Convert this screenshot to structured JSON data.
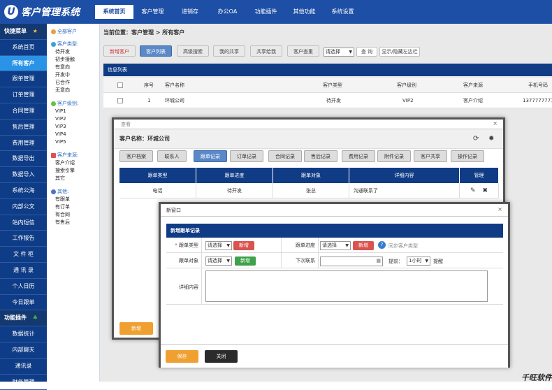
{
  "app": {
    "title": "客户管理系统",
    "logo": "U"
  },
  "topnav": [
    {
      "label": "系统首页"
    },
    {
      "label": "客户管理"
    },
    {
      "label": "进销存"
    },
    {
      "label": "办公OA"
    },
    {
      "label": "功能插件"
    },
    {
      "label": "其他功能"
    },
    {
      "label": "系统设置"
    }
  ],
  "sidebar": {
    "quick": "快捷菜单",
    "items": [
      {
        "label": "系统首页"
      },
      {
        "label": "所有客户"
      },
      {
        "label": "跟单管理"
      },
      {
        "label": "订单管理"
      },
      {
        "label": "合同管理"
      },
      {
        "label": "售后管理"
      },
      {
        "label": "费用管理"
      },
      {
        "label": "数据导出"
      },
      {
        "label": "数据导入"
      },
      {
        "label": "系统公海"
      },
      {
        "label": "内部公文"
      },
      {
        "label": "站内短信"
      },
      {
        "label": "工作报告"
      },
      {
        "label": "文 件 柜"
      },
      {
        "label": "通 讯 录"
      },
      {
        "label": "个人日历"
      },
      {
        "label": "今日跟单"
      }
    ],
    "plugins": "功能插件",
    "items2": [
      {
        "label": "数据统计"
      },
      {
        "label": "内部聊天"
      },
      {
        "label": "通讯录"
      },
      {
        "label": "财务管理"
      }
    ]
  },
  "tree": {
    "all": "全部客户",
    "g1": {
      "title": "客户类型:",
      "items": [
        "待开发",
        "初步接触",
        "有意向",
        "开发中",
        "已合作",
        "无意向"
      ]
    },
    "g2": {
      "title": "客户级别:",
      "items": [
        "VIP1",
        "VIP2",
        "VIP3",
        "VIP4",
        "VIP5"
      ]
    },
    "g3": {
      "title": "客户来源:",
      "items": [
        "客户介绍",
        "搜索引擎",
        "其它"
      ]
    },
    "g4": {
      "title": "其他:",
      "items": [
        "有跟单",
        "有订单",
        "有合同",
        "有售后"
      ]
    }
  },
  "main": {
    "breadcrumb": "当前位置：客户管理 > 所有客户",
    "toolbar": [
      "新增客户",
      "客户列表",
      "高级搜索",
      "我的共享",
      "共享给我",
      "客户查重"
    ],
    "select": "请选择",
    "search": "查 询",
    "toggle": "显示/隐藏左边栏",
    "info": "信息列表",
    "columns": [
      "序号",
      "客户名称",
      "客户类型",
      "客户级别",
      "客户来源",
      "手机号码"
    ],
    "row": {
      "no": "1",
      "name": "环城公司",
      "type": "待开发",
      "level": "VIP2",
      "source": "客户介绍",
      "phone": "13777777777"
    }
  },
  "dialog1": {
    "title": "查看",
    "close": "×",
    "customer": "客户名称：环城公司",
    "tabs": [
      "客户档案",
      "联系人",
      "跟单记录",
      "订单记录",
      "合同记录",
      "售后记录",
      "费用记录",
      "附件记录",
      "客户共享",
      "操作记录"
    ],
    "cols": [
      "跟单类型",
      "跟单进度",
      "跟单对象",
      "详细内容",
      "管理"
    ],
    "row": {
      "type": "电话",
      "progress": "待开发",
      "target": "张总",
      "detail": "沟通联系了"
    },
    "add": "新增"
  },
  "dialog2": {
    "title": "新窗口",
    "close": "×",
    "section": "新增跟单记录",
    "required": "*",
    "type_label": "跟单类型",
    "progress_label": "跟单进度",
    "target_label": "跟单对象",
    "next_label": "下次联系",
    "detail_label": "详细内容",
    "select": "请选择",
    "add": "新增",
    "sync": "同步客户类型",
    "remind": "提前：",
    "hour": "1小时",
    "remind2": "提醒",
    "save": "保存",
    "close_btn": "关闭"
  },
  "watermark": "千旺软件",
  "colors": {
    "nav": "#1d4fa6",
    "sidebar": "#0f3c86",
    "accent": "#2a93e6",
    "save": "#f0a030"
  }
}
